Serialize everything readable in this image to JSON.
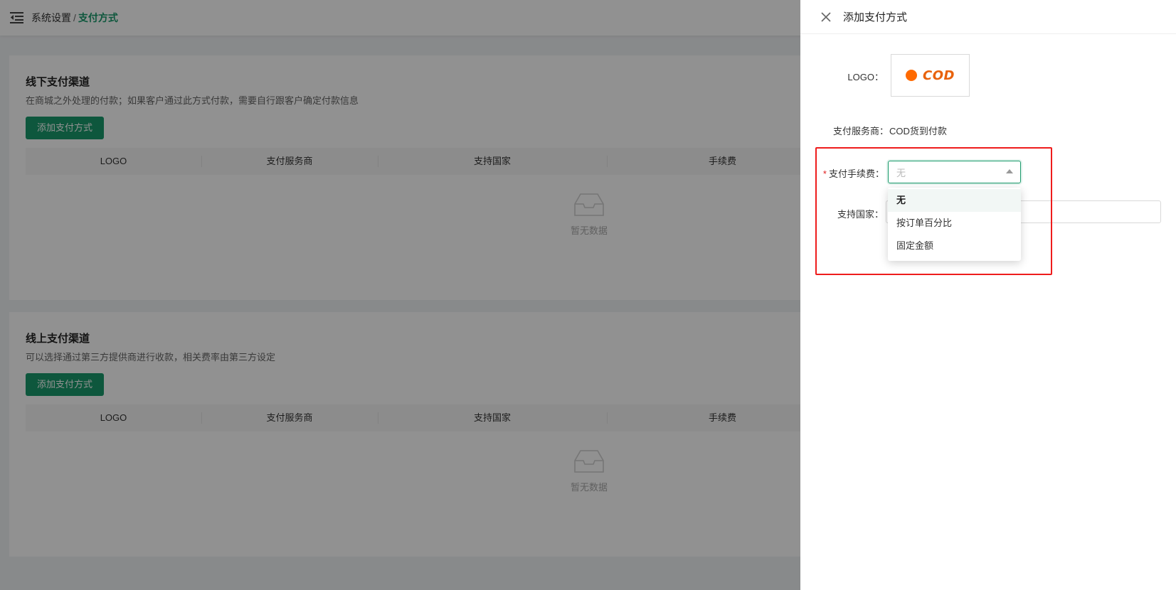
{
  "header": {
    "breadcrumb_parent": "系统设置",
    "breadcrumb_separator": "/",
    "breadcrumb_current": "支付方式"
  },
  "offline_section": {
    "title": "线下支付渠道",
    "description": "在商城之外处理的付款；如果客户通过此方式付款，需要自行跟客户确定付款信息",
    "add_button": "添加支付方式",
    "columns": [
      "LOGO",
      "支付服务商",
      "支持国家",
      "手续费"
    ],
    "empty_text": "暂无数据"
  },
  "online_section": {
    "title": "线上支付渠道",
    "description": "可以选择通过第三方提供商进行收款，相关费率由第三方设定",
    "add_button": "添加支付方式",
    "columns": [
      "LOGO",
      "支付服务商",
      "支持国家",
      "手续费"
    ],
    "empty_text": "暂无数据"
  },
  "drawer": {
    "title": "添加支付方式",
    "logo_label": "LOGO：",
    "logo_text": "COD",
    "provider_label": "支付服务商：",
    "provider_value": "COD货到付款",
    "fee_label": "支付手续费：",
    "fee_selected": "无",
    "fee_options": [
      "无",
      "按订单百分比",
      "固定金额"
    ],
    "country_label": "支持国家："
  },
  "colors": {
    "accent": "#1a9a6b",
    "required": "#e02020",
    "highlight": "#ee1c1c",
    "logo_orange": "#ff6a00"
  }
}
